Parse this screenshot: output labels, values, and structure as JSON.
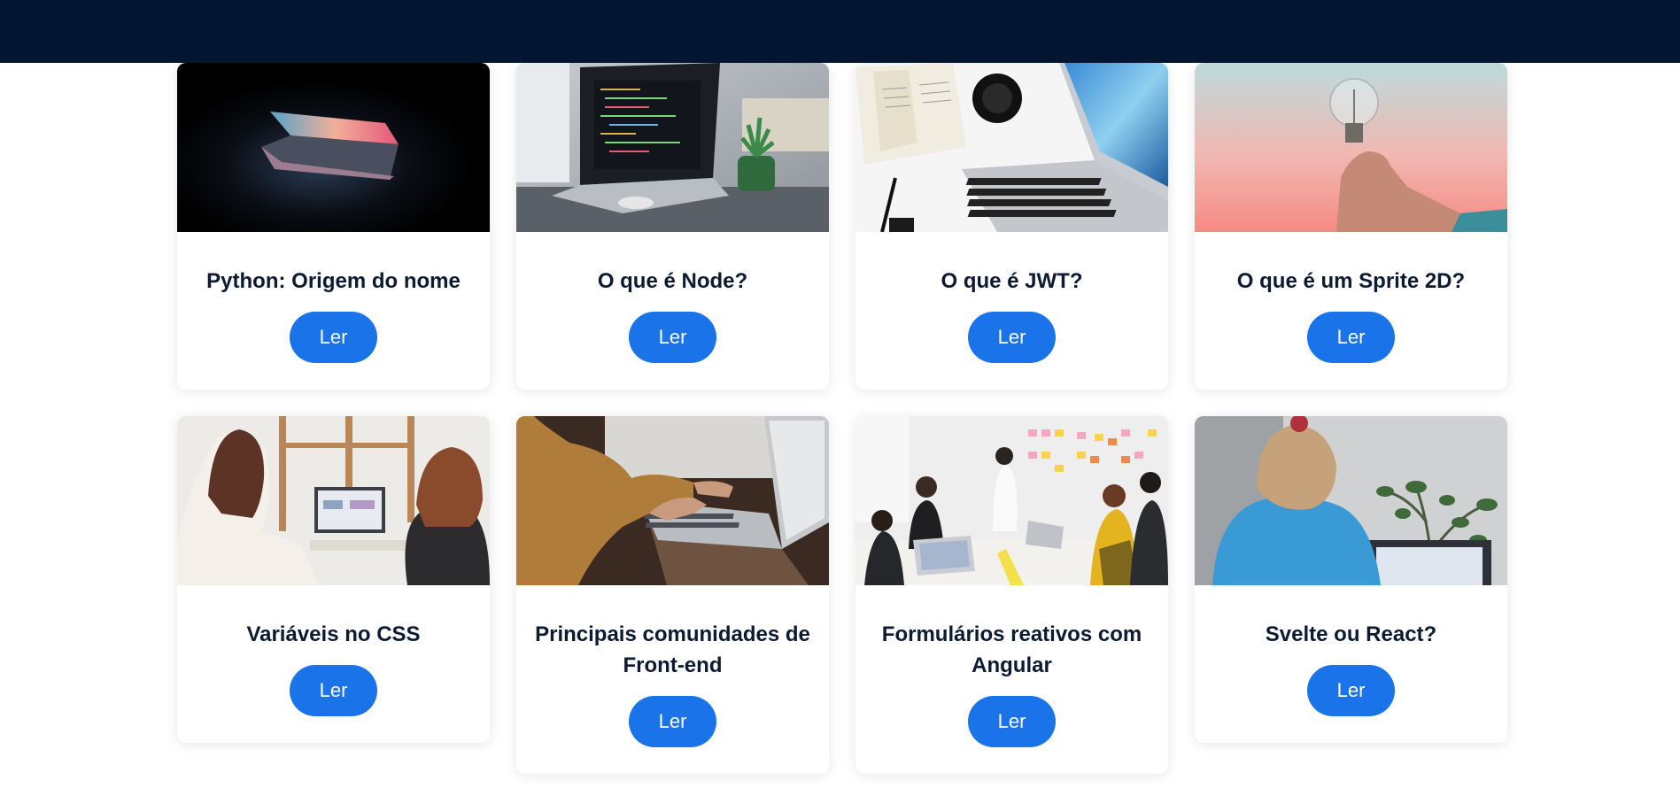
{
  "header": {
    "background": "#051633"
  },
  "colors": {
    "button": "#1a73e8",
    "title_text": "#0c1b33"
  },
  "cards": [
    {
      "title": "Python: Origem do nome",
      "button_label": "Ler",
      "image": "laptop-dark-glow-photo"
    },
    {
      "title": "O que é Node?",
      "button_label": "Ler",
      "image": "laptop-code-plant-photo"
    },
    {
      "title": "O que é JWT?",
      "button_label": "Ler",
      "image": "laptop-desk-flatlay-photo"
    },
    {
      "title": "O que é um Sprite 2D?",
      "button_label": "Ler",
      "image": "lightbulb-hand-photo"
    },
    {
      "title": "Variáveis no CSS",
      "button_label": "Ler",
      "image": "two-women-laptop-photo"
    },
    {
      "title": "Principais comunidades de Front-end",
      "button_label": "Ler",
      "image": "typing-laptop-photo"
    },
    {
      "title": "Formulários reativos com Angular",
      "button_label": "Ler",
      "image": "team-meeting-sticky-notes-photo"
    },
    {
      "title": "Svelte ou React?",
      "button_label": "Ler",
      "image": "woman-blue-sweater-laptop-photo"
    }
  ]
}
